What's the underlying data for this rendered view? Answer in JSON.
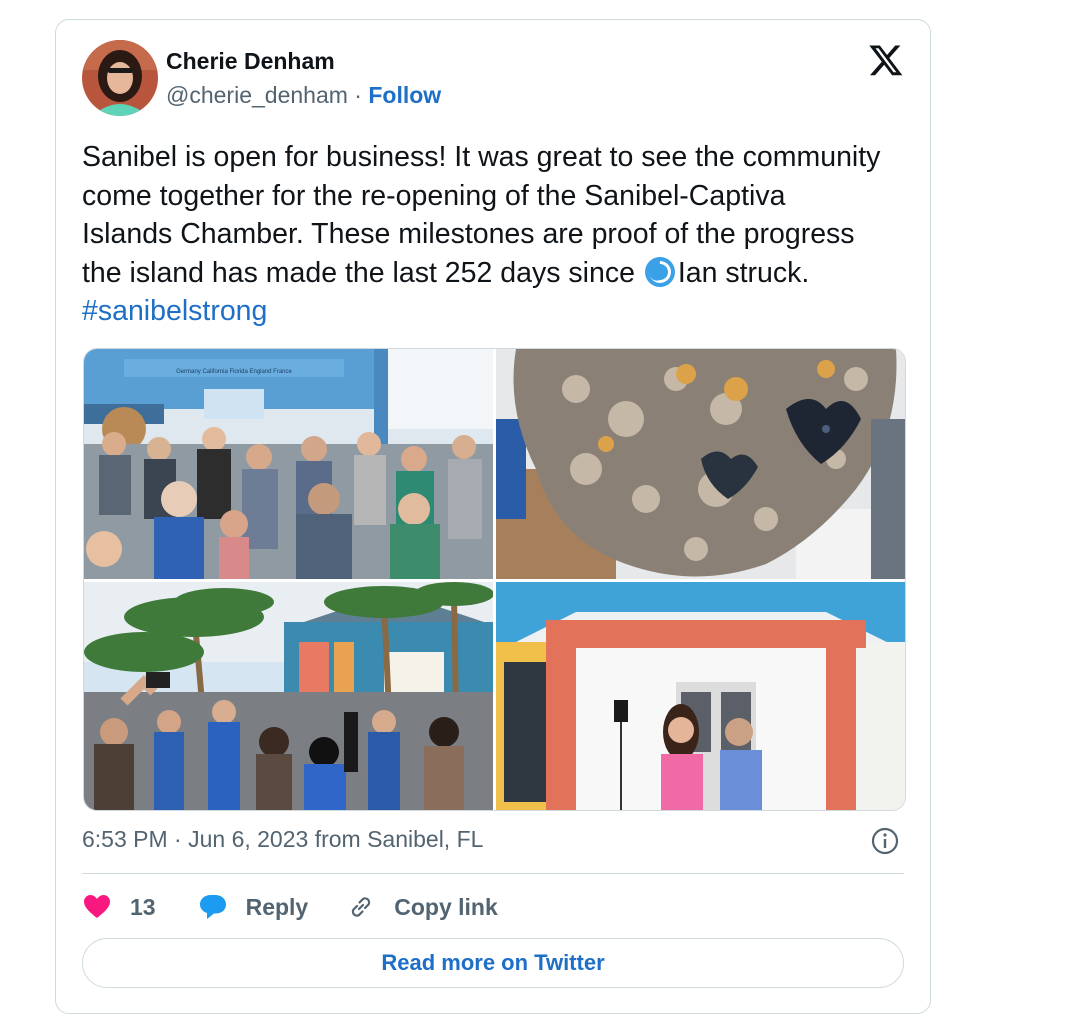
{
  "author": {
    "name": "Cherie Denham",
    "handle": "@cherie_denham",
    "separator": "·",
    "follow_label": "Follow",
    "avatar_icon": "user-avatar-photo"
  },
  "brand": {
    "logo_icon": "x-logo-icon"
  },
  "tweet": {
    "text_before_emoji": "Sanibel is open for business! It was great to see the community come together for the re-opening of the Sanibel-Captiva Islands Chamber. These milestones are proof of the progress the island has made the last 252 days since ",
    "emoji_icon": "cyclone-emoji-icon",
    "text_after_emoji": "Ian struck. ",
    "hashtag": "#sanibelstrong"
  },
  "media": {
    "photos": [
      {
        "name": "photo-chamber-crowd-indoor",
        "icon": "image"
      },
      {
        "name": "photo-shell-mosaic-sculpture",
        "icon": "image"
      },
      {
        "name": "photo-ribbon-cutting-outdoor",
        "icon": "image"
      },
      {
        "name": "photo-couple-at-entrance",
        "icon": "image"
      }
    ],
    "sign_text": "Germany California Florida England France"
  },
  "meta": {
    "timestamp": "6:53 PM · Jun 6, 2023 from Sanibel, FL",
    "info_icon": "info-icon"
  },
  "actions": {
    "like_count": "13",
    "reply_label": "Reply",
    "copy_link_label": "Copy link"
  },
  "read_more_label": "Read more on Twitter",
  "colors": {
    "accent": "#1d6fc7",
    "heart": "#f91880",
    "reply_bubble": "#1d9bf0",
    "muted": "#536471",
    "border": "#cfd9de"
  }
}
